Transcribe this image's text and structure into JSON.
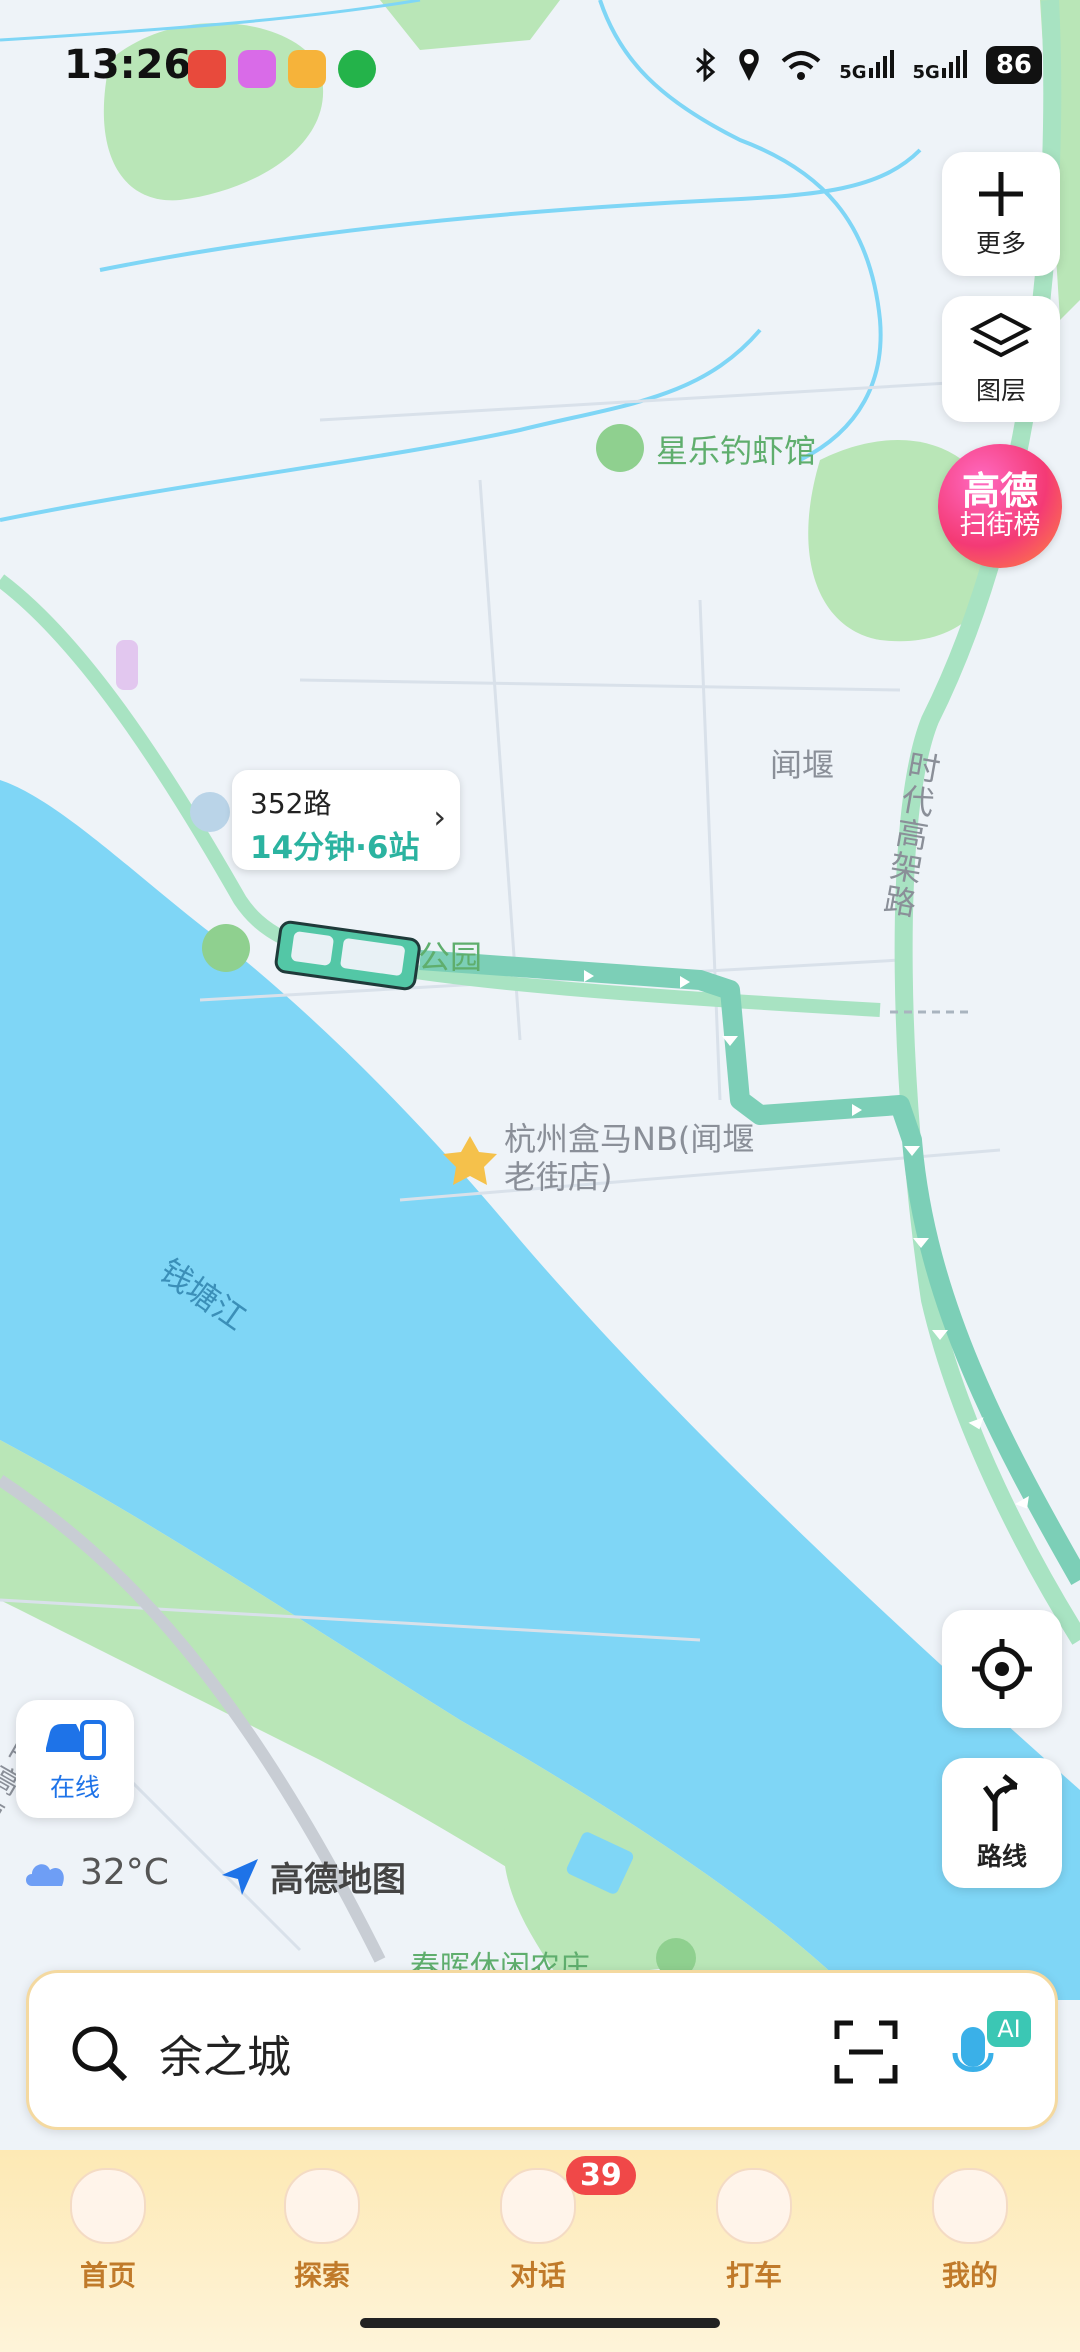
{
  "status_bar": {
    "time": "13:26",
    "signal_label": "5G",
    "battery": "86"
  },
  "map_controls": {
    "more_label": "更多",
    "layers_label": "图层",
    "badge_line1": "高德",
    "badge_line2": "扫街榜",
    "route_label": "路线"
  },
  "map_labels": {
    "poi_fishing": "星乐钓虾馆",
    "area": "闻堰",
    "road": "时代高架路",
    "river": "钱塘江",
    "poi_store": "杭州盒马NB(闻堰老街店)",
    "park": "公园",
    "expressway": "杭甬高速",
    "farm": "春晖休闲农庄"
  },
  "bus_popup": {
    "line": "352路",
    "eta": "14分钟·6站"
  },
  "online": {
    "label": "在线"
  },
  "weather": {
    "temp": "32°C"
  },
  "brand": {
    "name": "高德地图"
  },
  "search": {
    "text": "余之城"
  },
  "tabs": [
    {
      "label": "首页"
    },
    {
      "label": "探索"
    },
    {
      "label": "对话"
    },
    {
      "label": "打车"
    },
    {
      "label": "我的"
    }
  ],
  "chat_badge": "39",
  "colors": {
    "water": "#7fd6f6",
    "route": "#7ccfb7",
    "green_area": "#b7e7b5",
    "accent": "#2bb3a0"
  }
}
